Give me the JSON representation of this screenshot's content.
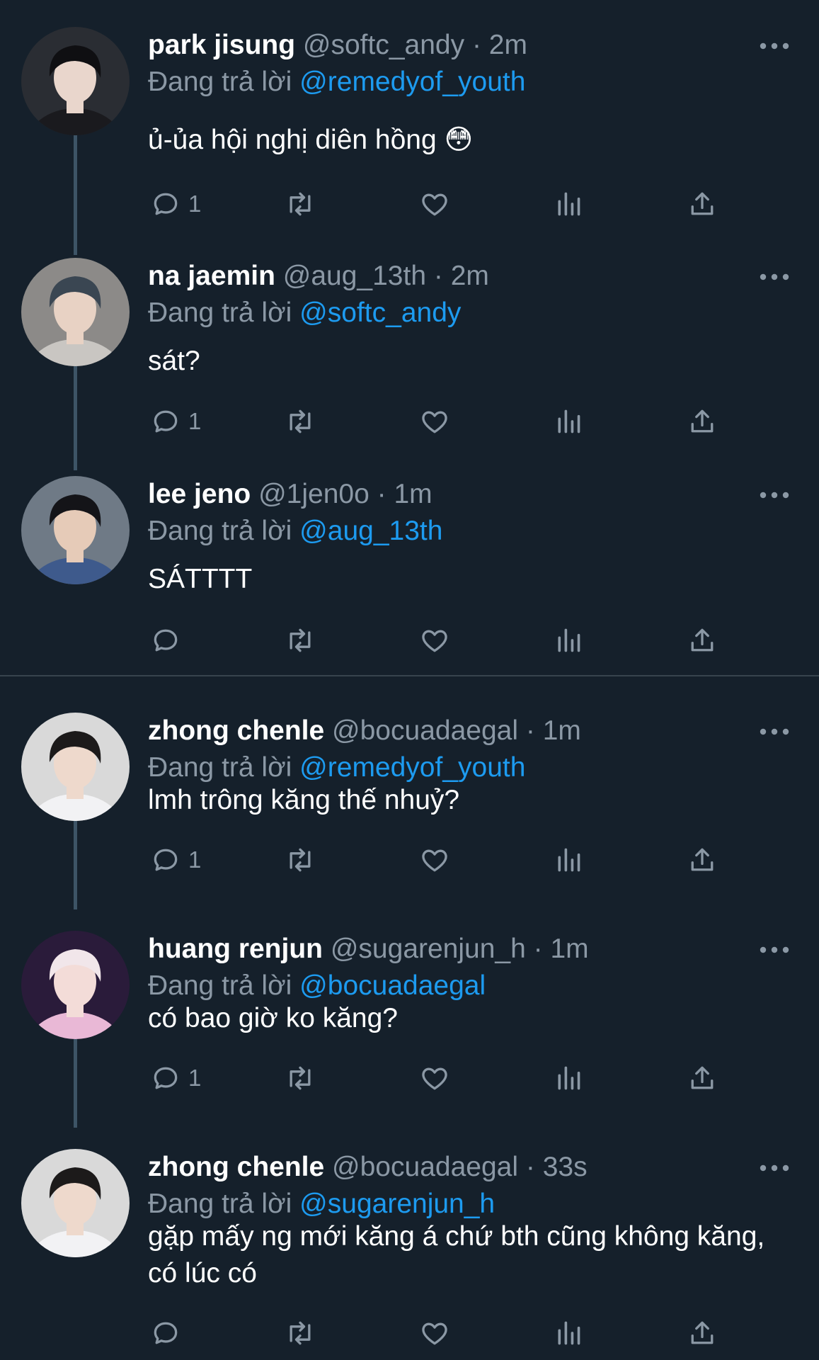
{
  "replying_label": "Đang trả lời",
  "tweets": [
    {
      "name": "park jisung",
      "handle": "@softc_andy",
      "separator": "·",
      "time": "2m",
      "reply_to": "@remedyof_youth",
      "text": "ủ-ủa hội nghị diên hồng 😳",
      "reply_count": "1",
      "avatar": {
        "bg": "#2a2d33",
        "hair": "#0f0f12",
        "skin": "#e9d6cc",
        "shirt": "#1a1a1e"
      }
    },
    {
      "name": "na jaemin",
      "handle": "@aug_13th",
      "separator": "·",
      "time": "2m",
      "reply_to": "@softc_andy",
      "text": "sát?",
      "reply_count": "1",
      "avatar": {
        "bg": "#8c8a88",
        "hair": "#3a4652",
        "skin": "#e8d2c4",
        "shirt": "#c9c6c2"
      }
    },
    {
      "name": "lee jeno",
      "handle": "@1jen0o",
      "separator": "·",
      "time": "1m",
      "reply_to": "@aug_13th",
      "text": "SÁTTTT",
      "reply_count": "",
      "avatar": {
        "bg": "#6f7a86",
        "hair": "#141418",
        "skin": "#e6cbb8",
        "shirt": "#3e5a8c"
      }
    },
    {
      "name": "zhong chenle",
      "handle": "@bocuadaegal",
      "separator": "·",
      "time": "1m",
      "reply_to": "@remedyof_youth",
      "text": "lmh trông kăng thế nhuỷ?",
      "reply_count": "1",
      "avatar": {
        "bg": "#d9d9d9",
        "hair": "#1c1a1a",
        "skin": "#eed9cc",
        "shirt": "#f2f2f4"
      }
    },
    {
      "name": "huang renjun",
      "handle": "@sugarenjun_h",
      "separator": "·",
      "time": "1m",
      "reply_to": "@bocuadaegal",
      "text": "có bao giờ ko kăng?",
      "reply_count": "1",
      "avatar": {
        "bg": "#2a1b3a",
        "hair": "#f1e6ea",
        "skin": "#f3dcd8",
        "shirt": "#e9b8d6"
      }
    },
    {
      "name": "zhong chenle",
      "handle": "@bocuadaegal",
      "separator": "·",
      "time": "33s",
      "reply_to": "@sugarenjun_h",
      "text": "gặp mấy ng mới kăng á chứ bth cũng không kăng, có lúc có",
      "reply_count": "",
      "avatar": {
        "bg": "#d9d9d9",
        "hair": "#1c1a1a",
        "skin": "#eed9cc",
        "shirt": "#f2f2f4"
      }
    }
  ],
  "colors": {
    "background": "#15202b",
    "muted": "#8b98a5",
    "link": "#1d9bf0",
    "thread_line": "#3d5466",
    "separator": "#38444d"
  },
  "icons": [
    "reply-icon",
    "retweet-icon",
    "like-icon",
    "views-icon",
    "share-icon",
    "more-icon"
  ]
}
